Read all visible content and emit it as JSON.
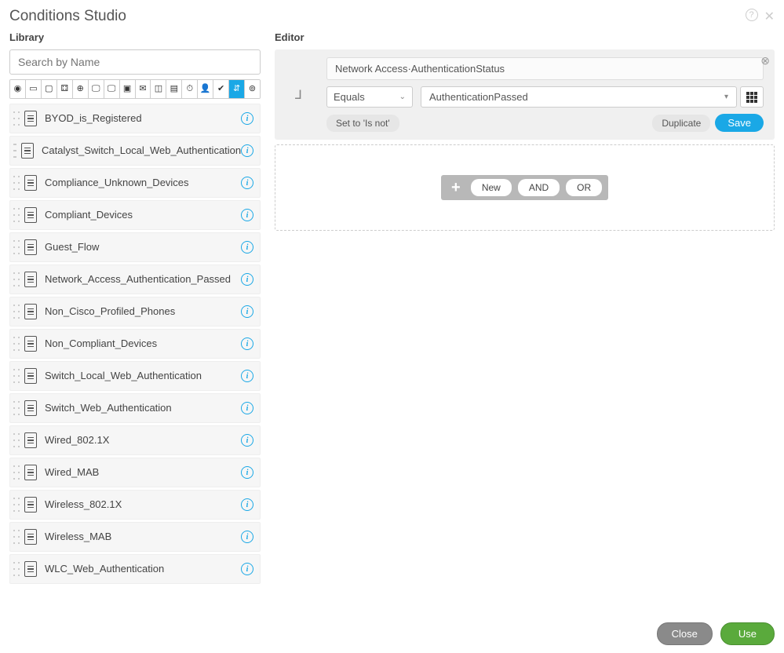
{
  "dialog": {
    "title": "Conditions Studio"
  },
  "library": {
    "label": "Library",
    "search_placeholder": "Search by Name",
    "items": [
      {
        "name": "BYOD_is_Registered"
      },
      {
        "name": "Catalyst_Switch_Local_Web_Authentication"
      },
      {
        "name": "Compliance_Unknown_Devices"
      },
      {
        "name": "Compliant_Devices"
      },
      {
        "name": "Guest_Flow"
      },
      {
        "name": "Network_Access_Authentication_Passed"
      },
      {
        "name": "Non_Cisco_Profiled_Phones"
      },
      {
        "name": "Non_Compliant_Devices"
      },
      {
        "name": "Switch_Local_Web_Authentication"
      },
      {
        "name": "Switch_Web_Authentication"
      },
      {
        "name": "Wired_802.1X"
      },
      {
        "name": "Wired_MAB"
      },
      {
        "name": "Wireless_802.1X"
      },
      {
        "name": "Wireless_MAB"
      },
      {
        "name": "WLC_Web_Authentication"
      }
    ]
  },
  "editor": {
    "label": "Editor",
    "attribute": "Network Access·AuthenticationStatus",
    "operator": "Equals",
    "value": "AuthenticationPassed",
    "set_isnot": "Set to 'Is not'",
    "duplicate": "Duplicate",
    "save": "Save",
    "add": {
      "new": "New",
      "and": "AND",
      "or": "OR"
    }
  },
  "footer": {
    "close": "Close",
    "use": "Use"
  },
  "icons": {
    "help": "?",
    "close": "✕",
    "info": "i",
    "caret": "⌄",
    "remove": "⊗",
    "plus": "+"
  },
  "filter_glyphs": [
    "◉",
    "▭",
    "▢",
    "⚃",
    "⊕",
    "🖵",
    "🖵",
    "▣",
    "✉",
    "◫",
    "▤",
    "⏱",
    "👤",
    "✔",
    "⇵",
    "⊚"
  ]
}
